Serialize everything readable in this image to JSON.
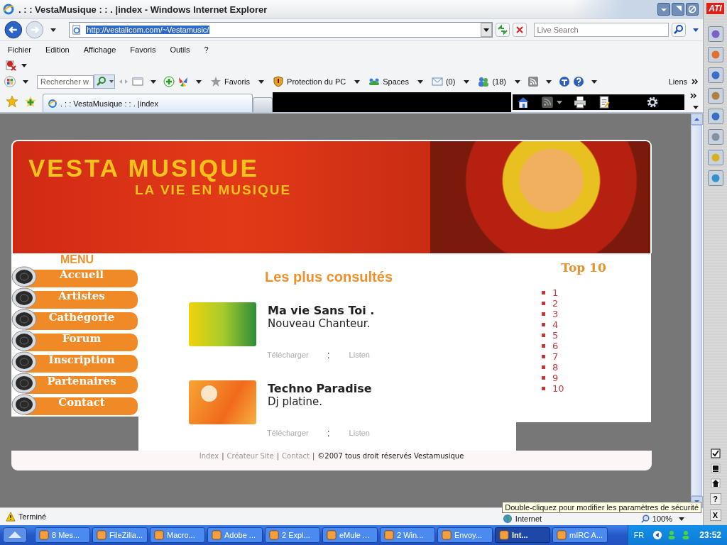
{
  "window": {
    "title": ". : : VestaMusique : : . |index - Windows Internet Explorer"
  },
  "address_bar": {
    "url": "http://vestalicom.com/~Vestamusic/",
    "search_placeholder": "Live Search"
  },
  "menu_bar": [
    "Fichier",
    "Edition",
    "Affichage",
    "Favoris",
    "Outils",
    "?"
  ],
  "toolbar": {
    "search_placeholder": "Rechercher w",
    "items": [
      {
        "kind": "star",
        "label": "Favoris"
      },
      {
        "kind": "shield",
        "label": "Protection du PC"
      },
      {
        "kind": "people",
        "label": "Spaces"
      },
      {
        "kind": "mail",
        "label": "(0)"
      },
      {
        "kind": "contacts",
        "label": "(18)"
      }
    ],
    "links": "Liens"
  },
  "tabs": [
    {
      "label": ". : : VestaMusique : : . |index",
      "selected": true
    }
  ],
  "site": {
    "banner": {
      "title": "VESTA MUSIQUE",
      "subtitle": "LA VIE EN MUSIQUE"
    },
    "menu": {
      "heading": "MENU",
      "items": [
        "Accueil",
        "Artistes",
        "Cathégorie",
        "Forum",
        "Inscription",
        "Partenaires",
        "Contact"
      ]
    },
    "main": {
      "heading": "Les plus consultés",
      "songs": [
        {
          "kind": "green",
          "title": "Ma vie Sans Toi .",
          "subtitle": "Nouveau Chanteur.",
          "download": "Télécharger",
          "separator": ":",
          "listen": "Listen"
        },
        {
          "kind": "orange",
          "title": "Techno Paradise",
          "subtitle": "Dj platine.",
          "download": "Télécharger",
          "separator": ":",
          "listen": "Listen"
        }
      ]
    },
    "top10": {
      "heading": "Top 10",
      "items": [
        "1",
        "2",
        "3",
        "4",
        "5",
        "6",
        "7",
        "8",
        "9",
        "10"
      ]
    },
    "footer": {
      "links": [
        "Index",
        "Créateur Site",
        "Contact"
      ],
      "separator": "|",
      "copyright": "©2007 tous droit réservés Vestamusique"
    }
  },
  "status_bar": {
    "text": "Terminé",
    "tooltip": "Double-cliquez pour modifier les paramètres de sécurité",
    "zone": "Internet",
    "zoom": "100%"
  },
  "side_strip": {
    "logo": "ATI",
    "buttons": [
      "?",
      "X"
    ]
  },
  "taskbar": {
    "items": [
      {
        "label": "8 Mes...",
        "selected": false
      },
      {
        "label": "FileZilla...",
        "selected": false
      },
      {
        "label": "Macro...",
        "selected": false
      },
      {
        "label": "Adobe ...",
        "selected": false
      },
      {
        "label": "2 Expl...",
        "selected": false
      },
      {
        "label": "eMule ...",
        "selected": false
      },
      {
        "label": "2 Win...",
        "selected": false
      },
      {
        "label": "Envoy...",
        "selected": false
      },
      {
        "label": "Int...",
        "selected": true
      },
      {
        "label": "mIRC A...",
        "selected": false
      }
    ],
    "language": "FR",
    "clock": "23:52"
  }
}
